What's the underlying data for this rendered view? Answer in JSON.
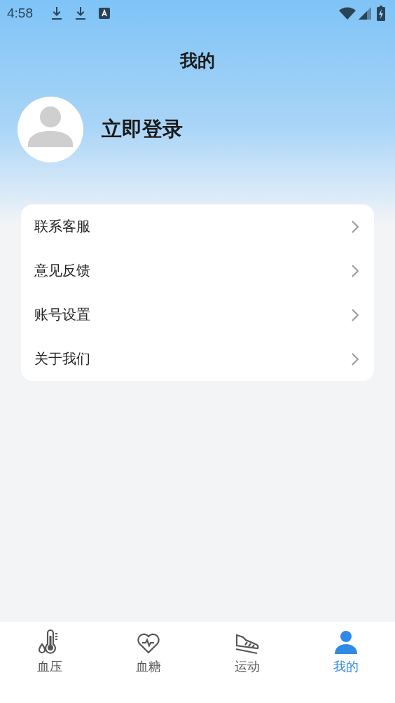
{
  "status_bar": {
    "time": "4:58"
  },
  "header": {
    "title": "我的"
  },
  "profile": {
    "login": "立即登录"
  },
  "menu": [
    {
      "label": "联系客服"
    },
    {
      "label": "意见反馈"
    },
    {
      "label": "账号设置"
    },
    {
      "label": "关于我们"
    }
  ],
  "tab_bar": [
    {
      "label": "血压",
      "kind": "thermometer",
      "selected": false
    },
    {
      "label": "血糖",
      "kind": "heart",
      "selected": false
    },
    {
      "label": "运动",
      "kind": "shoe",
      "selected": false
    },
    {
      "label": "我的",
      "kind": "person",
      "selected": true
    }
  ]
}
